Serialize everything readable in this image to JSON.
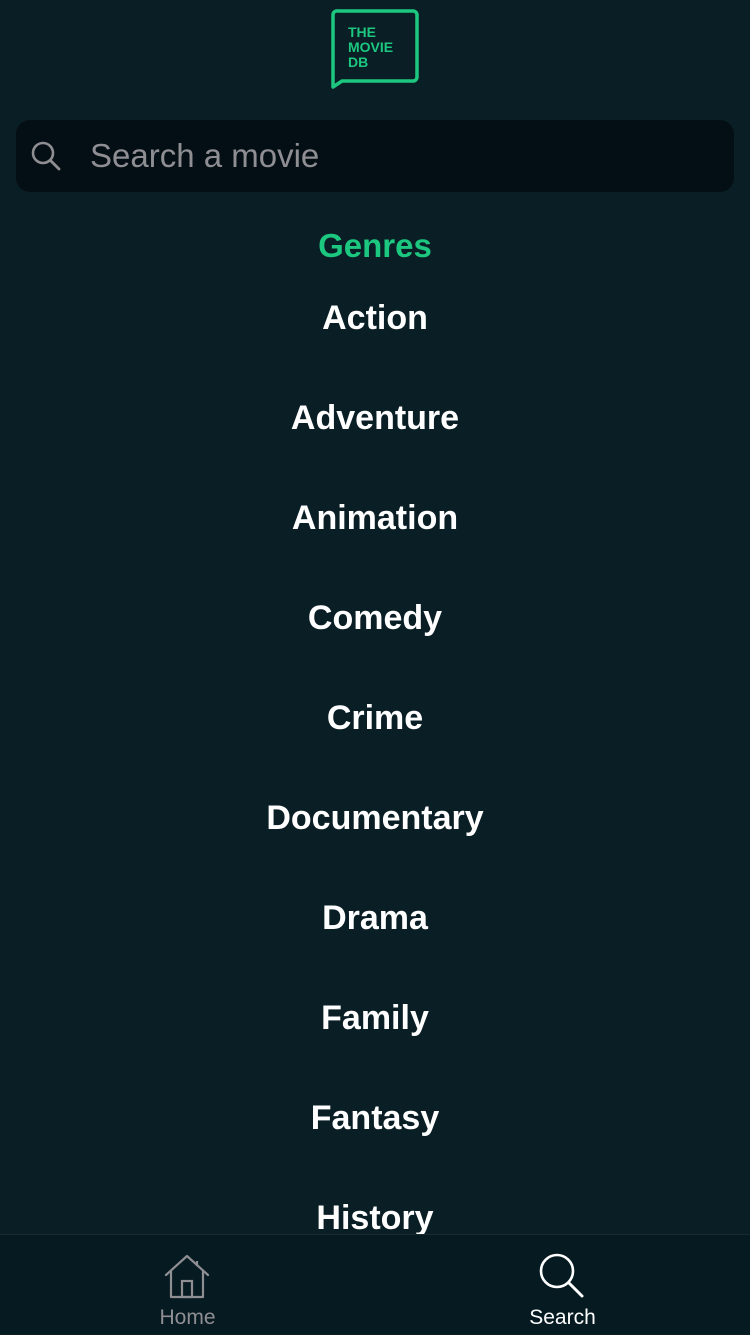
{
  "logo": {
    "line1": "THE",
    "line2": "MOVIE",
    "line3": "DB",
    "color": "#1cc780",
    "icon": "tmdb-logo"
  },
  "search": {
    "placeholder": "Search a movie",
    "value": "",
    "icon": "search-icon"
  },
  "genres": {
    "title": "Genres",
    "items": [
      "Action",
      "Adventure",
      "Animation",
      "Comedy",
      "Crime",
      "Documentary",
      "Drama",
      "Family",
      "Fantasy",
      "History"
    ]
  },
  "tabbar": {
    "home_label": "Home",
    "search_label": "Search",
    "active": "Search",
    "home_icon": "home-icon",
    "search_icon": "search-icon"
  },
  "colors": {
    "background": "#0a1e25",
    "accent": "#1cc780",
    "search_bg": "#040f15",
    "tabbar_bg": "#061a21",
    "inactive": "#8e8e93"
  }
}
